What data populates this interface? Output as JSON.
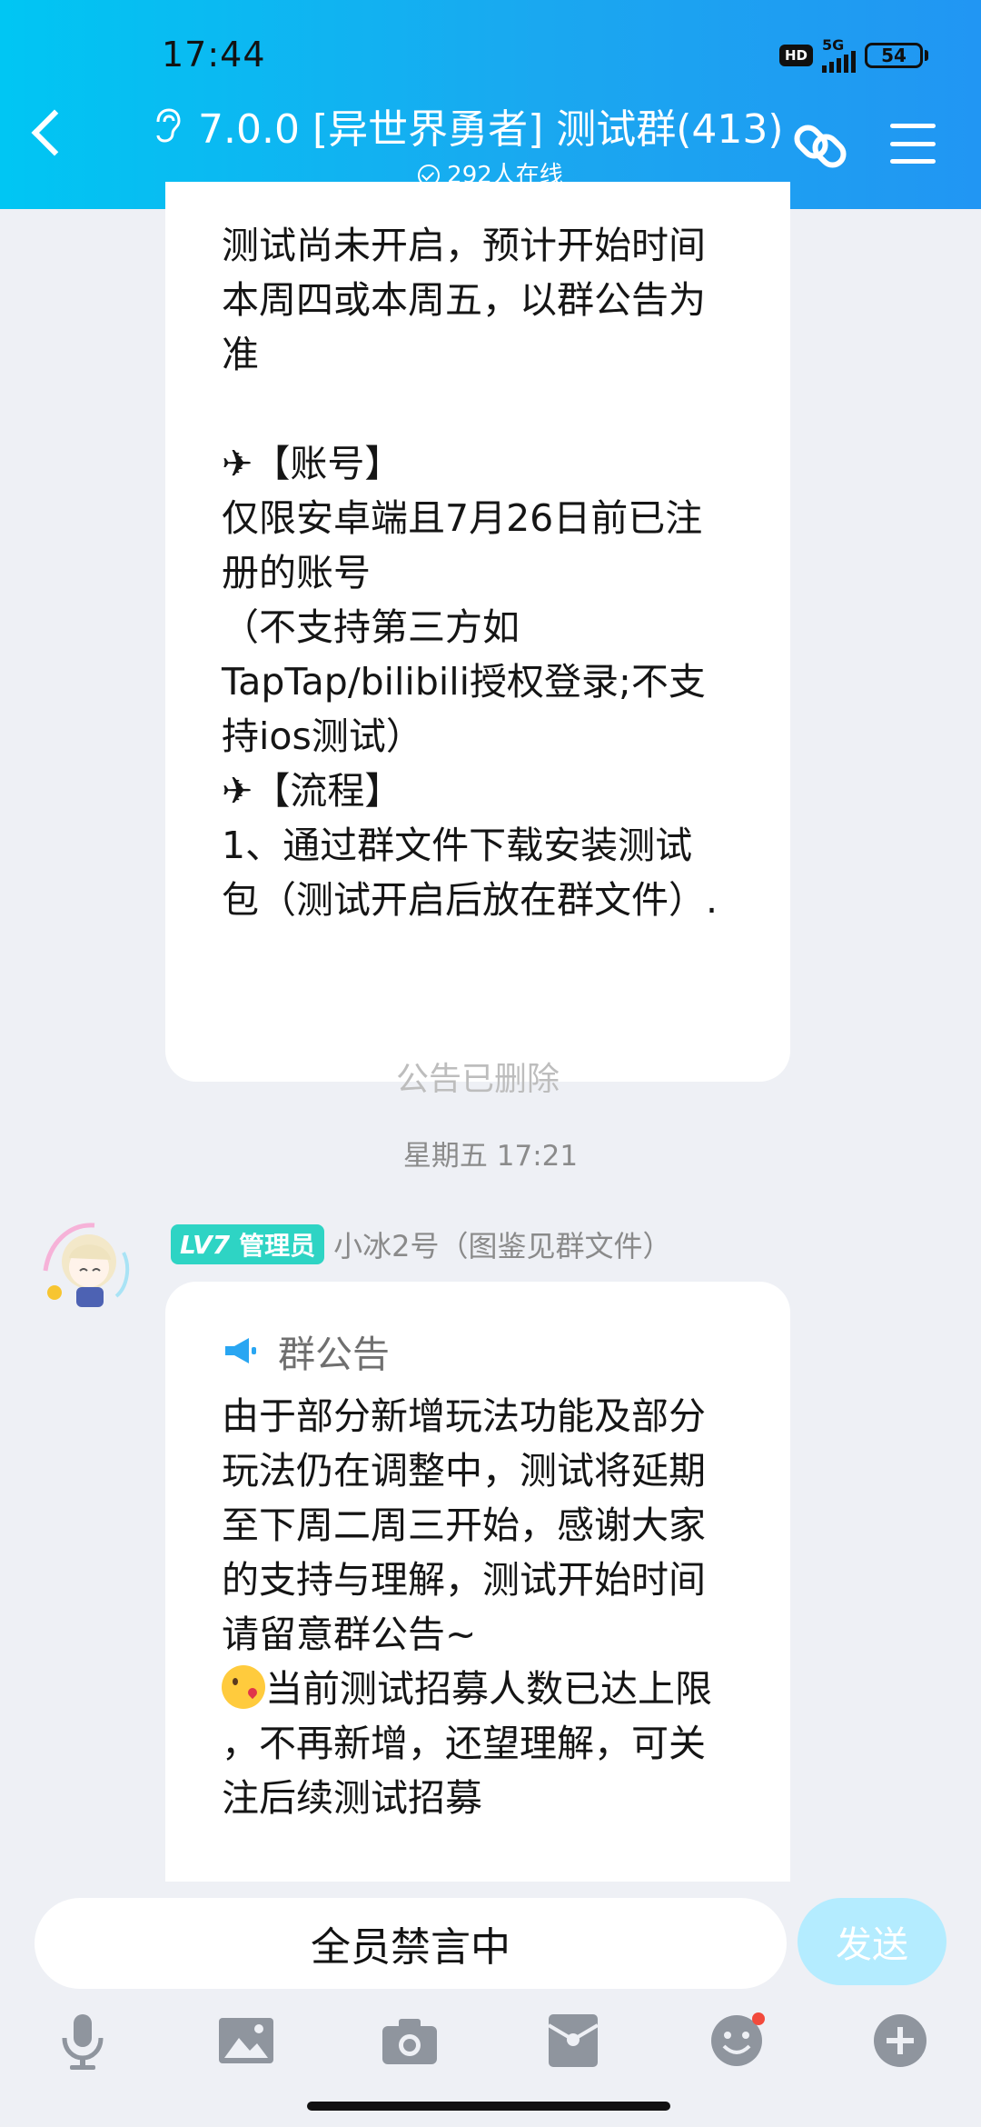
{
  "status_bar": {
    "time": "17:44",
    "hd": "HD",
    "network": "5G",
    "battery": "54"
  },
  "header": {
    "title": "7.0.0 [异世界勇者] 测试群(413)",
    "online": "292人在线"
  },
  "messages": {
    "first": {
      "lines": [
        "测试尚未开启，预计开始时间",
        "本周四或本周五，以群公告为",
        "准",
        "",
        "✈【账号】",
        "仅限安卓端且7月26日前已注",
        "册的账号",
        "（不支持第三方如",
        "TapTap/bilibili授权登录;不支",
        "持ios测试）",
        "✈【流程】",
        "1、通过群文件下载安装测试",
        "包（测试开启后放在群文件）."
      ],
      "deleted_note": "公告已删除"
    },
    "date_separator": "星期五 17:21",
    "second": {
      "sender_level": "LV7",
      "sender_role": "管理员",
      "sender_name": "小冰2号（图鉴见群文件）",
      "announcement_label": "群公告",
      "lines": [
        "由于部分新增玩法功能及部分",
        "玩法仍在调整中，测试将延期",
        "至下周二周三开始，感谢大家",
        "的支持与理解，测试开始时间",
        "请留意群公告~"
      ],
      "emoji_line": "当前测试招募人数已达上限",
      "lines_after": [
        "，不再新增，还望理解，可关",
        "注后续测试招募"
      ]
    }
  },
  "input": {
    "muted_text": "全员禁言中",
    "send_label": "发送"
  },
  "toolbar": {
    "icons": [
      "microphone-icon",
      "image-icon",
      "camera-icon",
      "red-packet-icon",
      "emoji-icon",
      "plus-icon"
    ]
  },
  "colors": {
    "header_start": "#00c6f3",
    "header_end": "#2196f3",
    "badge": "#2ed4c4",
    "send_disabled": "#b4ecff",
    "notification_dot": "#f24a3c"
  }
}
